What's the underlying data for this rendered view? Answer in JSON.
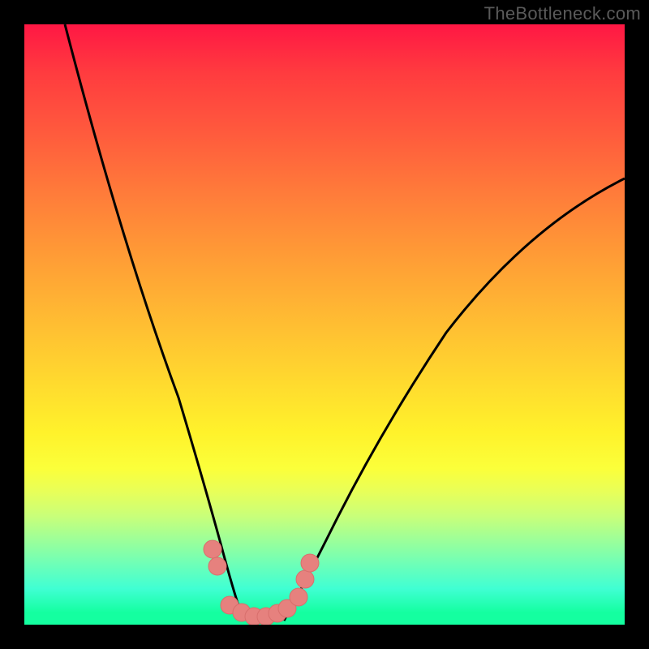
{
  "watermark": "TheBottleneck.com",
  "chart_data": {
    "type": "line",
    "title": "",
    "xlabel": "",
    "ylabel": "",
    "xlim": [
      0,
      100
    ],
    "ylim": [
      0,
      100
    ],
    "grid": false,
    "legend": false,
    "background_gradient": {
      "direction": "vertical",
      "stops": [
        {
          "pos": 0,
          "color": "#ff1744"
        },
        {
          "pos": 50,
          "color": "#ffd52f"
        },
        {
          "pos": 78,
          "color": "#e7ff5a"
        },
        {
          "pos": 100,
          "color": "#14ffa0"
        }
      ]
    },
    "series": [
      {
        "name": "left-curve",
        "x": [
          0,
          5,
          10,
          15,
          20,
          25,
          30,
          33,
          35
        ],
        "y": [
          100,
          84,
          68,
          53,
          40,
          28,
          16,
          6,
          0
        ]
      },
      {
        "name": "right-curve",
        "x": [
          43,
          46,
          50,
          55,
          60,
          70,
          80,
          90,
          100
        ],
        "y": [
          0,
          4,
          10,
          18,
          26,
          40,
          53,
          64,
          74
        ]
      }
    ],
    "markers": {
      "name": "highlight-dots",
      "color": "#e6817e",
      "points": [
        {
          "x": 29,
          "y": 12
        },
        {
          "x": 30,
          "y": 9
        },
        {
          "x": 32,
          "y": 2.5
        },
        {
          "x": 34,
          "y": 1.5
        },
        {
          "x": 36,
          "y": 1
        },
        {
          "x": 38,
          "y": 1
        },
        {
          "x": 40,
          "y": 1.5
        },
        {
          "x": 42,
          "y": 2
        },
        {
          "x": 44,
          "y": 4
        },
        {
          "x": 45,
          "y": 7
        },
        {
          "x": 46,
          "y": 10
        }
      ]
    }
  }
}
